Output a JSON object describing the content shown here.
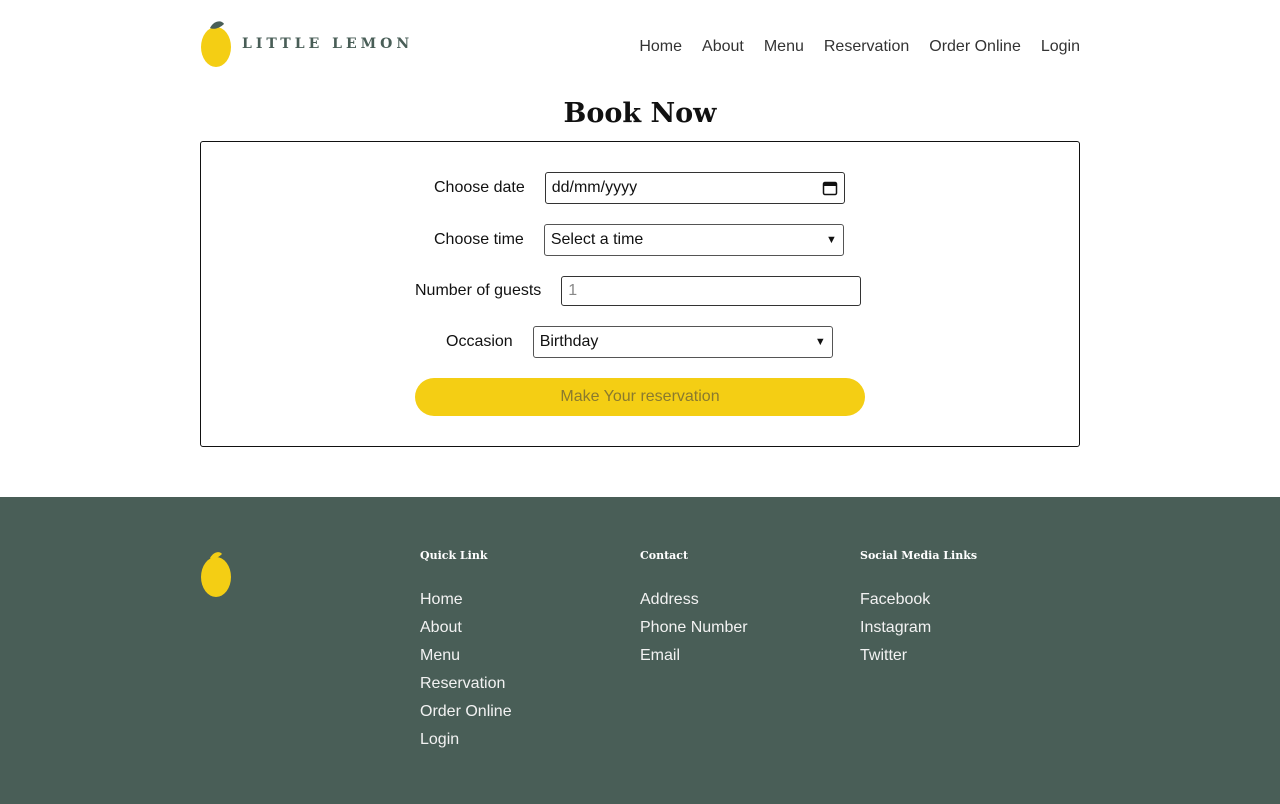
{
  "brand": {
    "name": "LITTLE LEMON",
    "accent": "#F4CE14",
    "primary": "#495E57"
  },
  "nav": [
    "Home",
    "About",
    "Menu",
    "Reservation",
    "Order Online",
    "Login"
  ],
  "page_title": "Book Now",
  "form": {
    "date_label": "Choose date",
    "date_value": "dd/mm/yyyy",
    "time_label": "Choose time",
    "time_value": "Select a time",
    "guests_label": "Number of guests",
    "guests_placeholder": "1",
    "occasion_label": "Occasion",
    "occasion_value": "Birthday",
    "submit_label": "Make Your reservation"
  },
  "footer": {
    "quick_link_title": "Quick Link",
    "quick_links": [
      "Home",
      "About",
      "Menu",
      "Reservation",
      "Order Online",
      "Login"
    ],
    "contact_title": "Contact",
    "contact_links": [
      "Address",
      "Phone Number",
      "Email"
    ],
    "social_title": "Social Media Links",
    "social_links": [
      "Facebook",
      "Instagram",
      "Twitter"
    ]
  }
}
